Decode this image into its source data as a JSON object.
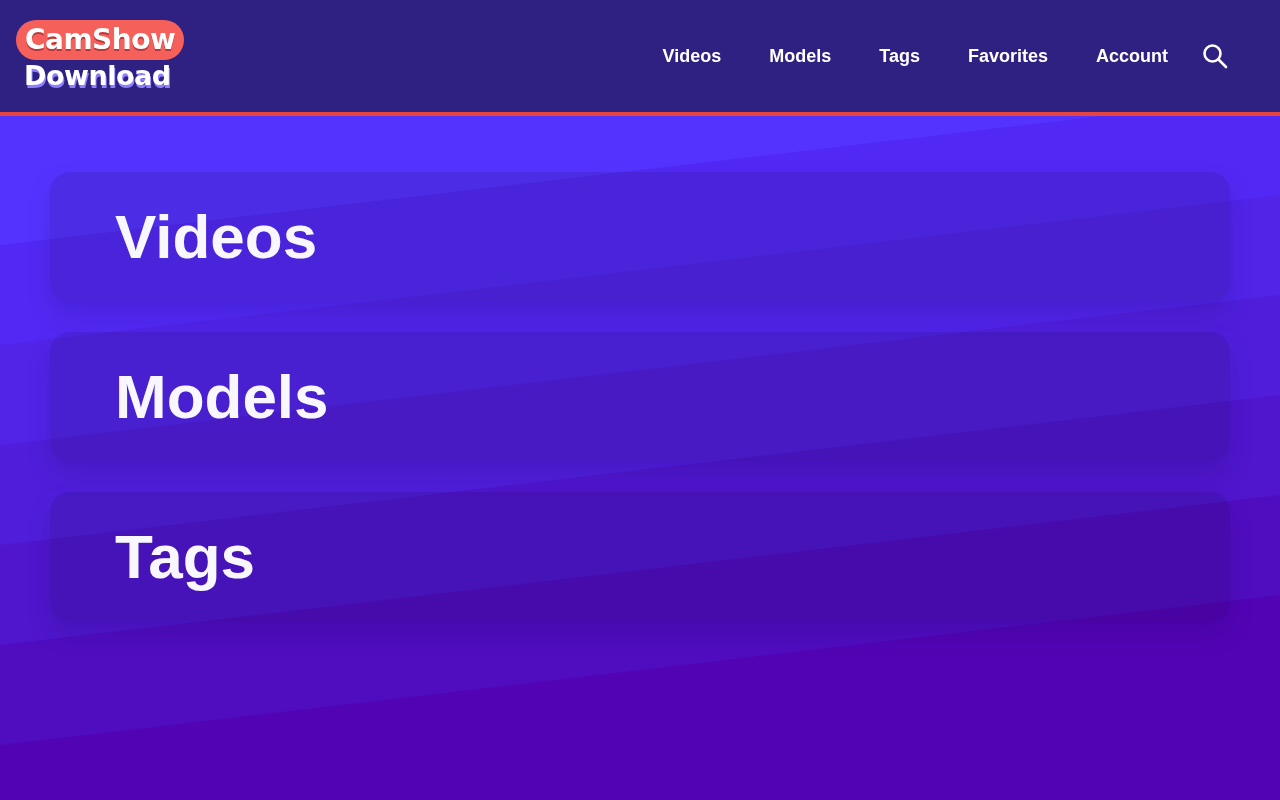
{
  "header": {
    "logo": {
      "line_1": "CamShow",
      "line_2": "Download"
    },
    "nav": [
      {
        "label": "Videos"
      },
      {
        "label": "Models"
      },
      {
        "label": "Tags"
      },
      {
        "label": "Favorites"
      },
      {
        "label": "Account"
      }
    ]
  },
  "sections": [
    {
      "title": "Videos"
    },
    {
      "title": "Models"
    },
    {
      "title": "Tags"
    }
  ]
}
